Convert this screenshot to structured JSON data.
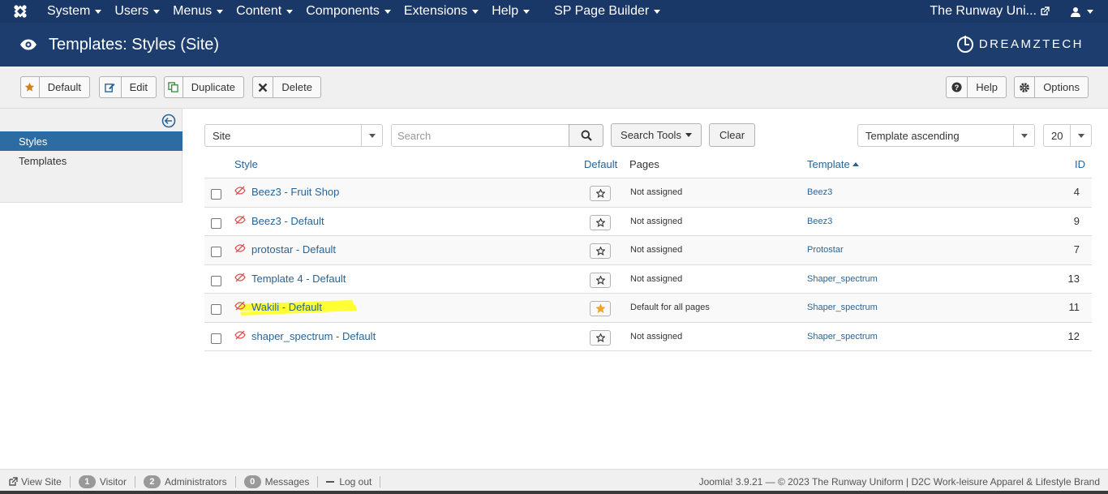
{
  "topnav": {
    "menu": [
      "System",
      "Users",
      "Menus",
      "Content",
      "Components",
      "Extensions",
      "Help",
      "SP Page Builder"
    ],
    "site_name": "The Runway Uni...",
    "user_icon": "user-icon"
  },
  "header": {
    "title": "Templates: Styles (Site)",
    "brand": "DREAMZTECH"
  },
  "toolbar": {
    "default_label": "Default",
    "edit_label": "Edit",
    "duplicate_label": "Duplicate",
    "delete_label": "Delete",
    "help_label": "Help",
    "options_label": "Options"
  },
  "sidebar": {
    "items": [
      {
        "label": "Styles",
        "active": true
      },
      {
        "label": "Templates",
        "active": false
      }
    ]
  },
  "filters": {
    "client": "Site",
    "search_placeholder": "Search",
    "search_tools_label": "Search Tools",
    "clear_label": "Clear",
    "ordering": "Template ascending",
    "limit": "20"
  },
  "table": {
    "headers": {
      "style": "Style",
      "default": "Default",
      "pages": "Pages",
      "template": "Template",
      "id": "ID"
    },
    "rows": [
      {
        "style": "Beez3 - Fruit Shop",
        "is_default": false,
        "pages": "Not assigned",
        "template": "Beez3",
        "id": "4"
      },
      {
        "style": "Beez3 - Default",
        "is_default": false,
        "pages": "Not assigned",
        "template": "Beez3",
        "id": "9"
      },
      {
        "style": "protostar - Default",
        "is_default": false,
        "pages": "Not assigned",
        "template": "Protostar",
        "id": "7"
      },
      {
        "style": "Template 4 - Default",
        "is_default": false,
        "pages": "Not assigned",
        "template": "Shaper_spectrum",
        "id": "13"
      },
      {
        "style": "Wakili - Default",
        "is_default": true,
        "pages": "Default for all pages",
        "template": "Shaper_spectrum",
        "id": "11"
      },
      {
        "style": "shaper_spectrum - Default",
        "is_default": false,
        "pages": "Not assigned",
        "template": "Shaper_spectrum",
        "id": "12"
      }
    ]
  },
  "statusbar": {
    "view_site": "View Site",
    "visitor_count": "1",
    "visitor_label": "Visitor",
    "admin_count": "2",
    "admin_label": "Administrators",
    "messages_count": "0",
    "messages_label": "Messages",
    "logout_label": "Log out",
    "footer": "Joomla! 3.9.21 — © 2023 The Runway Uniform | D2C Work-leisure Apparel & Lifestyle Brand"
  },
  "colors": {
    "nav_bg": "#1a3867",
    "header_bg": "#1c3d6e",
    "link": "#2a6496",
    "active_sidebar": "#2d6ca2",
    "highlight": "#ffff33",
    "star_default": "#f0a52a"
  }
}
